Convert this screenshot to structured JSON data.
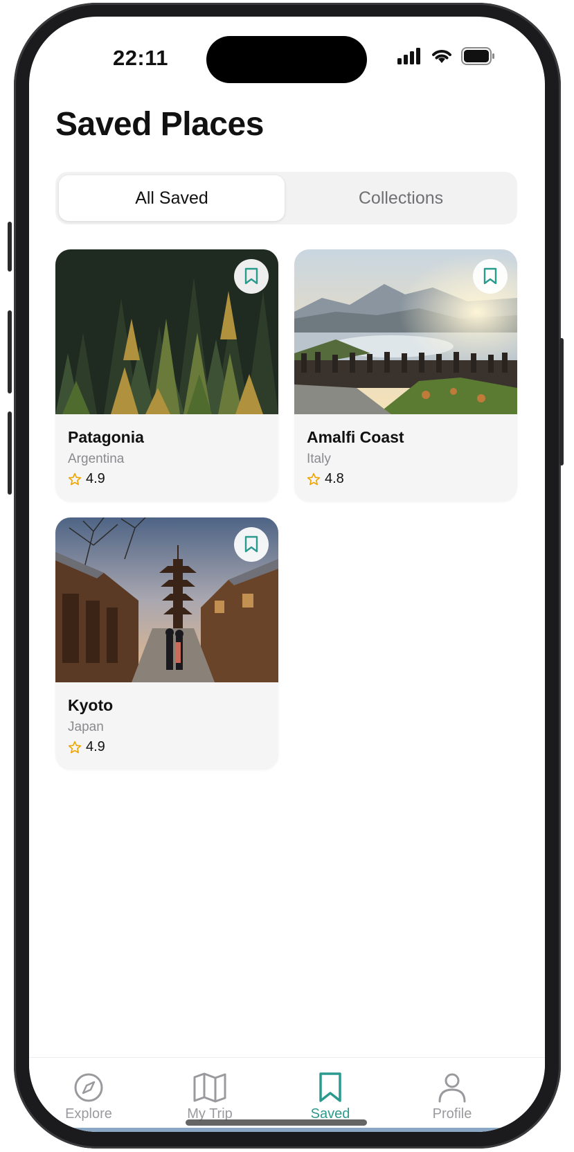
{
  "status_bar": {
    "time": "22:11"
  },
  "header": {
    "title": "Saved Places"
  },
  "segments": {
    "all_saved": "All Saved",
    "collections": "Collections",
    "selected": "All Saved"
  },
  "places": [
    {
      "name": "Patagonia",
      "country": "Argentina",
      "rating": "4.9",
      "image": "pine forest"
    },
    {
      "name": "Amalfi Coast",
      "country": "Italy",
      "rating": "4.8",
      "image": "coastal viewpoint at sunset"
    },
    {
      "name": "Kyoto",
      "country": "Japan",
      "rating": "4.9",
      "image": "pagoda street at dusk"
    }
  ],
  "tabbar": {
    "tabs": [
      {
        "label": "Explore",
        "icon": "compass-icon"
      },
      {
        "label": "My Trip",
        "icon": "map-icon"
      },
      {
        "label": "Saved",
        "icon": "bookmark-icon"
      },
      {
        "label": "Profile",
        "icon": "person-icon"
      }
    ],
    "active": "Saved"
  },
  "colors": {
    "accent": "#2b9a8e",
    "star": "#f0a500",
    "muted": "#8a8a8e"
  }
}
